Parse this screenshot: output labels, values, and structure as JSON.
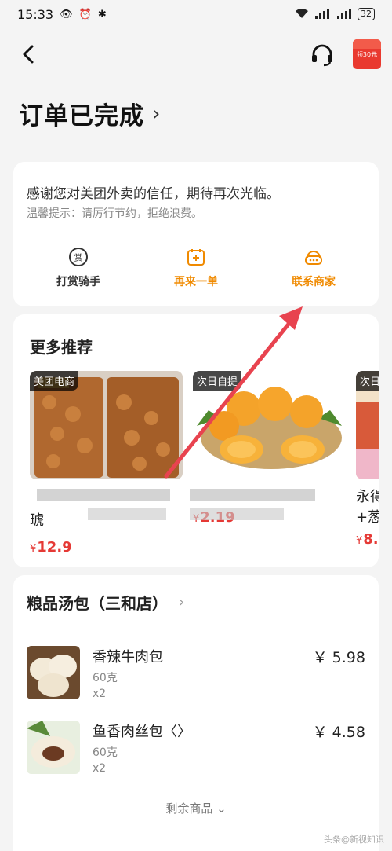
{
  "status_bar": {
    "time": "15:33",
    "battery": "32"
  },
  "header": {
    "title": "订单已完成",
    "red_envelope_text": "领30元"
  },
  "order_card": {
    "thanks": "感谢您对美团外卖的信任，期待再次光临。",
    "tip": "温馨提示：请厉行节约，拒绝浪费。",
    "actions": [
      {
        "label": "打赏骑手",
        "icon": "reward-icon"
      },
      {
        "label": "再来一单",
        "icon": "reorder-icon"
      },
      {
        "label": "联系商家",
        "icon": "chat-icon"
      }
    ]
  },
  "recommend": {
    "title": "更多推荐",
    "products": [
      {
        "tag": "美团电商",
        "name_visible": "琥",
        "price": "12.9"
      },
      {
        "tag": "次日自提",
        "name_visible": "",
        "price": "2.19"
      },
      {
        "tag": "次日",
        "name_visible": "永得\n+葱",
        "price": "8."
      }
    ],
    "currency": "¥"
  },
  "store": {
    "name": "粮品汤包（三和店）",
    "items": [
      {
        "name": "香辣牛肉包",
        "spec": "60克",
        "qty": "x2",
        "price": "￥ 5.98"
      },
      {
        "name": "鱼香肉丝包〈〉",
        "spec": "60克",
        "qty": "x2",
        "price": "￥ 4.58"
      }
    ],
    "more_label": "剩余商品"
  },
  "watermark": "头条@新视知识",
  "colors": {
    "accent_orange": "#f08a00",
    "price_red": "#e53935",
    "annotation_arrow": "#e8434f"
  }
}
